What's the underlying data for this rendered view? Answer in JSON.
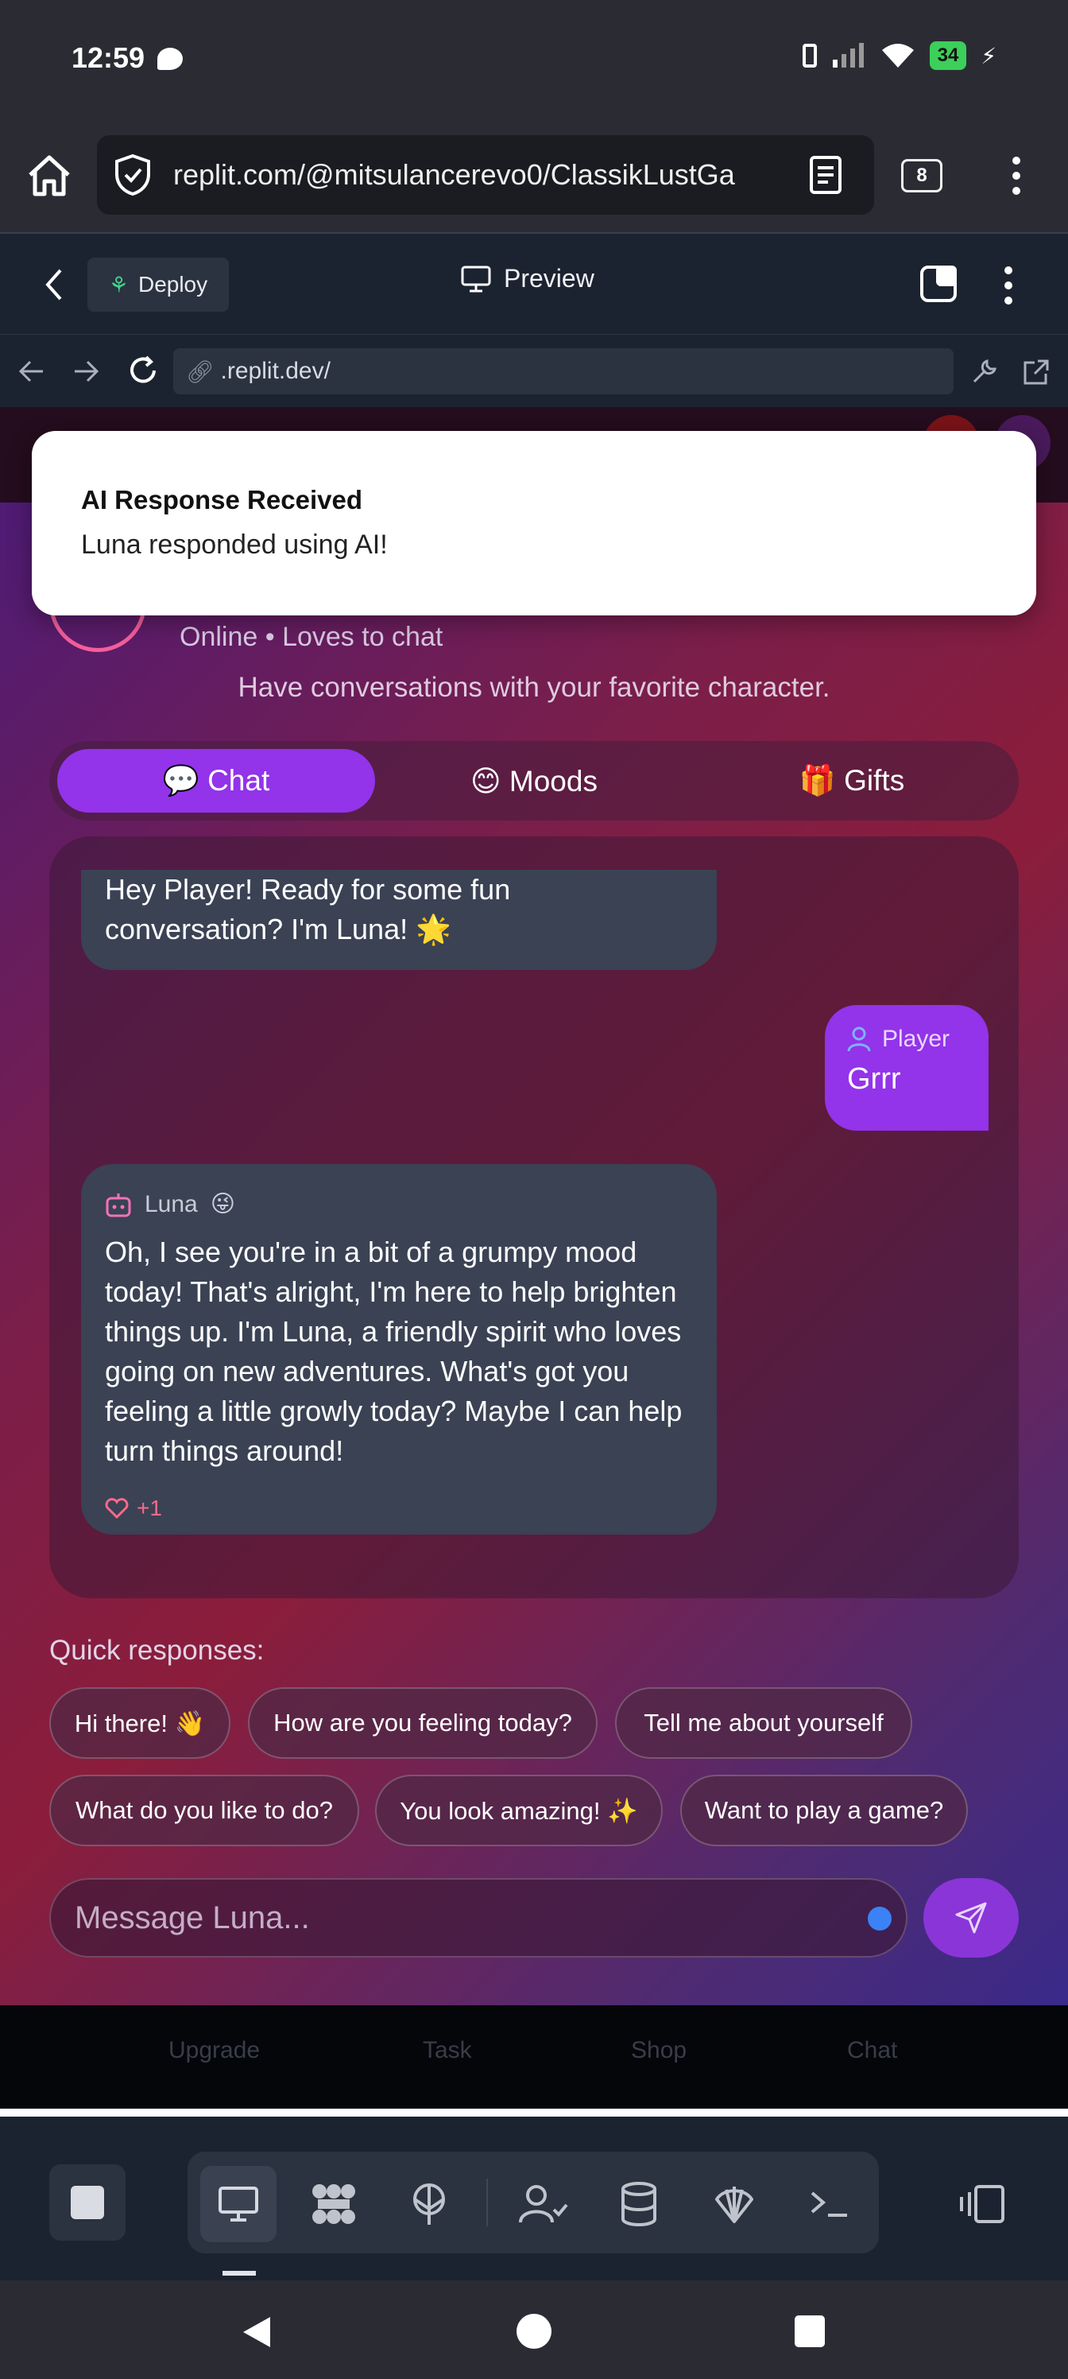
{
  "status_bar": {
    "time": "12:59",
    "battery": "34"
  },
  "browser": {
    "url": "replit.com/@mitsulancerevo0/ClassikLustGa",
    "tab_count": "8"
  },
  "replit_header": {
    "deploy_label": "Deploy",
    "preview_label": "Preview"
  },
  "mini_nav": {
    "url": ".replit.dev/"
  },
  "toast": {
    "title": "AI Response Received",
    "body": "Luna responded using AI!"
  },
  "character": {
    "status": "Online • Loves to chat",
    "subtitle": "Have conversations with your favorite character."
  },
  "tabs": [
    {
      "label": "💬 Chat"
    },
    {
      "label": "😊 Moods"
    },
    {
      "label": "🎁 Gifts"
    }
  ],
  "messages": [
    {
      "text": "Hey Player! Ready for some fun conversation? I'm Luna! 🌟"
    },
    {
      "sender": "Player",
      "text": "Grrr"
    },
    {
      "sender": "Luna",
      "emoji": "😜",
      "text": "Oh, I see you're in a bit of a grumpy mood today! That's alright, I'm here to help brighten things up. I'm Luna, a friendly spirit who loves going on new adventures. What's got you feeling a little growly today? Maybe I can help turn things around!",
      "likes": "+1"
    }
  ],
  "quick_responses": {
    "label": "Quick responses:",
    "items": [
      "Hi there! 👋",
      "How are you feeling today?",
      "Tell me about yourself",
      "What do you like to do?",
      "You look amazing! ✨",
      "Want to play a game?"
    ]
  },
  "composer": {
    "placeholder": "Message Luna..."
  },
  "app_nav": [
    "Upgrade",
    "Task",
    "Shop",
    "Chat"
  ]
}
